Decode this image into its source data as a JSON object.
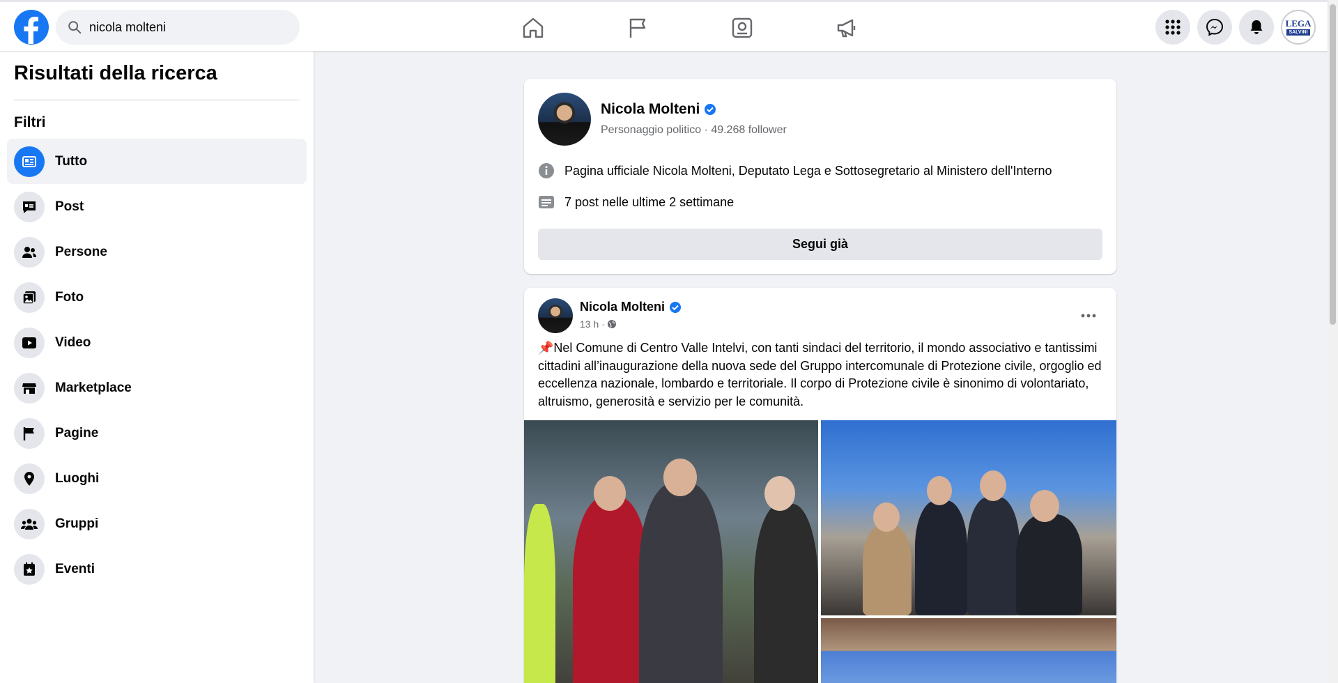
{
  "topbar": {
    "search_value": "nicola molteni",
    "nav": [
      "home-icon",
      "pages-flag-icon",
      "gaming-icon",
      "ads-megaphone-icon"
    ],
    "right": [
      "menu-grid-icon",
      "messenger-icon",
      "notifications-bell-icon",
      "profile-avatar"
    ],
    "avatar_logo_text": "LEGA",
    "avatar_logo_sub": "SALVINI"
  },
  "sidebar": {
    "title": "Risultati della ricerca",
    "filters_label": "Filtri",
    "items": [
      {
        "label": "Tutto",
        "icon": "all-results-icon",
        "active": true
      },
      {
        "label": "Post",
        "icon": "post-icon"
      },
      {
        "label": "Persone",
        "icon": "people-icon"
      },
      {
        "label": "Foto",
        "icon": "photo-icon"
      },
      {
        "label": "Video",
        "icon": "video-icon"
      },
      {
        "label": "Marketplace",
        "icon": "marketplace-icon"
      },
      {
        "label": "Pagine",
        "icon": "pages-flag-icon"
      },
      {
        "label": "Luoghi",
        "icon": "location-pin-icon"
      },
      {
        "label": "Gruppi",
        "icon": "groups-icon"
      },
      {
        "label": "Eventi",
        "icon": "events-icon"
      }
    ]
  },
  "page_result": {
    "name": "Nicola Molteni",
    "subtitle": "Personaggio politico · 49.268 follower",
    "description": "Pagina ufficiale Nicola Molteni, Deputato Lega e Sottosegretario al Ministero dell'Interno",
    "activity": "7 post nelle ultime 2 settimane",
    "follow_label": "Segui già"
  },
  "post": {
    "author": "Nicola Molteni",
    "time": "13 h ·",
    "text": "📌Nel Comune di Centro Valle Intelvi, con tanti sindaci del territorio, il mondo associativo e tantissimi cittadini all’inaugurazione della nuova sede del Gruppo intercomunale di Protezione civile, orgoglio ed eccellenza nazionale, lombardo e territoriale. Il corpo di Protezione civile è sinonimo di volontariato, altruismo, generosità e servizio per le comunità."
  },
  "colors": {
    "brand": "#1877f2",
    "verified": "#1877f2",
    "bg": "#f0f2f5"
  }
}
